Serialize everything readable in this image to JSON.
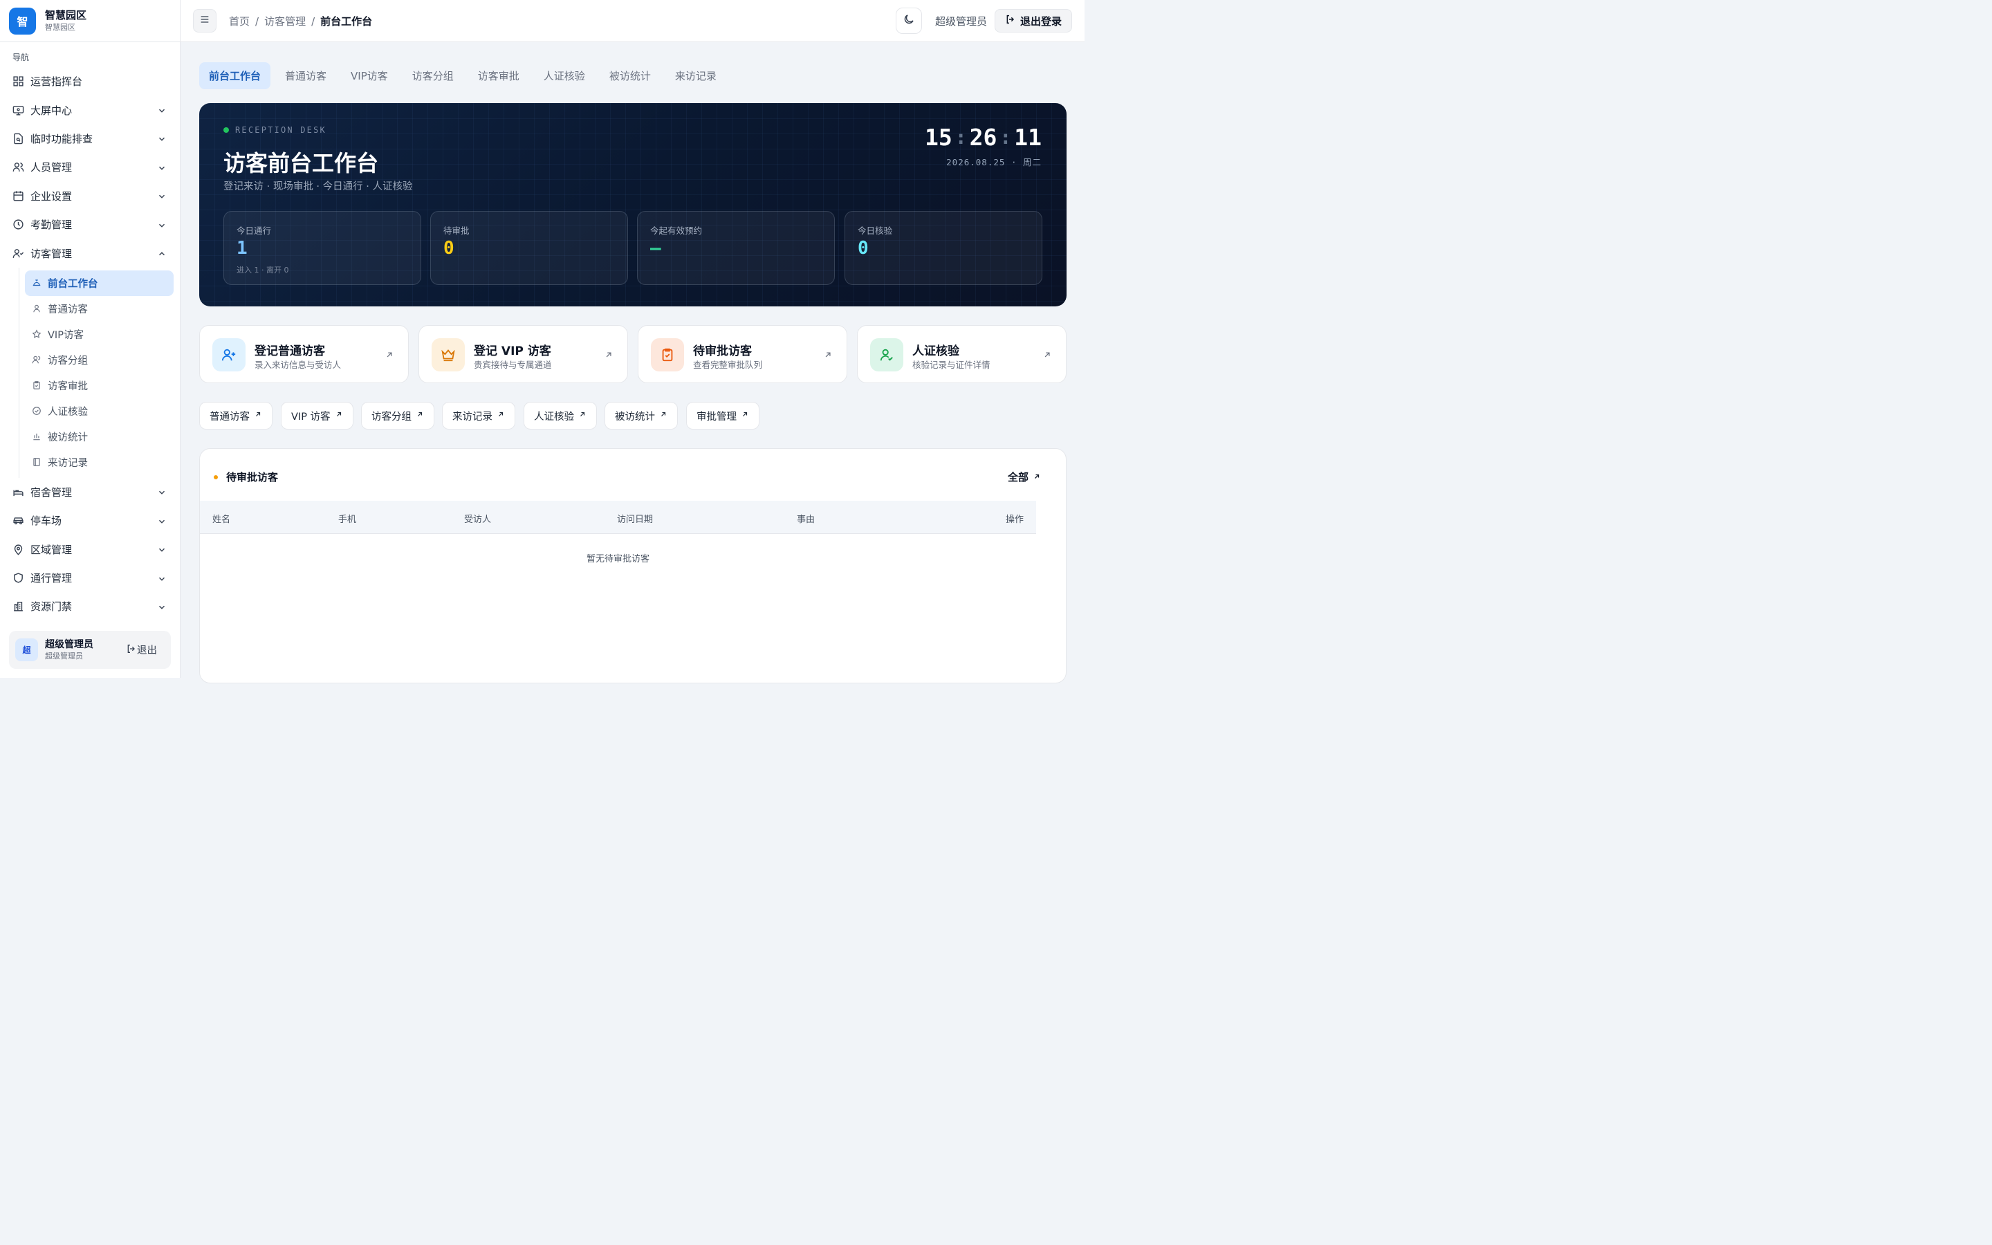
{
  "brand": {
    "logo": "智",
    "title": "智慧园区",
    "subtitle": "智慧园区"
  },
  "sidebar": {
    "section": "导航",
    "items": [
      {
        "label": "运营指挥台",
        "icon": "dashboard-icon"
      },
      {
        "label": "大屏中心",
        "icon": "monitor-icon"
      },
      {
        "label": "临时功能排查",
        "icon": "file-search-icon"
      },
      {
        "label": "人员管理",
        "icon": "users-icon"
      },
      {
        "label": "企业设置",
        "icon": "calendar-icon"
      },
      {
        "label": "考勤管理",
        "icon": "clock-icon"
      },
      {
        "label": "访客管理",
        "icon": "user-check-icon"
      },
      {
        "label": "宿舍管理",
        "icon": "bed-icon"
      },
      {
        "label": "停车场",
        "icon": "car-icon"
      },
      {
        "label": "区域管理",
        "icon": "map-pin-icon"
      },
      {
        "label": "通行管理",
        "icon": "shield-icon"
      },
      {
        "label": "资源门禁",
        "icon": "building-icon"
      }
    ],
    "visitor_sub": [
      {
        "label": "前台工作台",
        "icon": "bell-desk-icon"
      },
      {
        "label": "普通访客",
        "icon": "user-icon"
      },
      {
        "label": "VIP访客",
        "icon": "star-icon"
      },
      {
        "label": "访客分组",
        "icon": "users-icon"
      },
      {
        "label": "访客审批",
        "icon": "clipboard-check-icon"
      },
      {
        "label": "人证核验",
        "icon": "check-circle-icon"
      },
      {
        "label": "被访统计",
        "icon": "bar-chart-icon"
      },
      {
        "label": "来访记录",
        "icon": "book-icon"
      }
    ],
    "user": {
      "avatar": "超",
      "name": "超级管理员",
      "role": "超级管理员",
      "logout": "退出"
    }
  },
  "header": {
    "breadcrumb": [
      "首页",
      "访客管理",
      "前台工作台"
    ],
    "separator": "/",
    "role": "超级管理员",
    "logout": "退出登录"
  },
  "tabs": [
    "前台工作台",
    "普通访客",
    "VIP访客",
    "访客分组",
    "访客审批",
    "人证核验",
    "被访统计",
    "来访记录"
  ],
  "hero": {
    "tag": "RECEPTION DESK",
    "title": "访客前台工作台",
    "subtitle": "登记来访 · 现场审批 · 今日通行 · 人证核验",
    "clock": {
      "h": "15",
      "m": "26",
      "s": "11"
    },
    "date": "2026.08.25 · 周二",
    "stats": [
      {
        "label": "今日通行",
        "value": "1",
        "note": "进入 1 · 离开 0",
        "color": "#7cc4ff"
      },
      {
        "label": "待审批",
        "value": "0",
        "note": "",
        "color": "#facc15"
      },
      {
        "label": "今起有效预约",
        "value": "—",
        "note": "",
        "color": "#34d399"
      },
      {
        "label": "今日核验",
        "value": "0",
        "note": "",
        "color": "#67e8f9"
      }
    ]
  },
  "quick": [
    {
      "title": "登记普通访客",
      "sub": "录入来访信息与受访人",
      "icon": "user-plus-icon",
      "bg": "#e0f2fe",
      "fg": "#1677e6"
    },
    {
      "title": "登记 VIP 访客",
      "sub": "贵宾接待与专属通道",
      "icon": "crown-icon",
      "bg": "#fdf0dc",
      "fg": "#d97706"
    },
    {
      "title": "待审批访客",
      "sub": "查看完整审批队列",
      "icon": "clipboard-check-icon",
      "bg": "#fde7dc",
      "fg": "#ea580c"
    },
    {
      "title": "人证核验",
      "sub": "核验记录与证件详情",
      "icon": "user-check-icon",
      "bg": "#dcf5e9",
      "fg": "#16a34a"
    }
  ],
  "chips": [
    "普通访客",
    "VIP 访客",
    "访客分组",
    "来访记录",
    "人证核验",
    "被访统计",
    "审批管理"
  ],
  "pending": {
    "title": "待审批访客",
    "all": "全部",
    "columns": [
      "姓名",
      "手机",
      "受访人",
      "访问日期",
      "事由",
      "操作"
    ],
    "empty": "暂无待审批访客"
  }
}
